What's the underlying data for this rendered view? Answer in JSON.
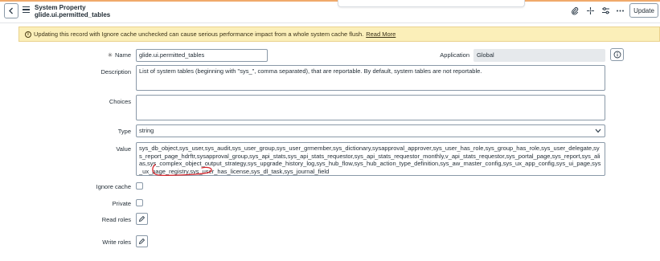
{
  "header": {
    "title_line1": "System Property",
    "title_line2": "glide.ui.permitted_tables",
    "update_label": "Update",
    "icons": [
      "back-icon",
      "menu-icon",
      "paperclip-icon",
      "activity-icon",
      "sliders-icon",
      "more-icon"
    ]
  },
  "warning": {
    "text": "Updating this record with Ignore cache unchecked can cause serious performance impact from a whole system cache flush.",
    "link": "Read More"
  },
  "form": {
    "name_label": "Name",
    "name_value": "glide.ui.permitted_tables",
    "application_label": "Application",
    "application_value": "Global",
    "description_label": "Description",
    "description_value": "List of system tables (beginning with \"sys_\", comma separated), that are reportable. By default, system tables are not reportable.",
    "choices_label": "Choices",
    "choices_value": "",
    "type_label": "Type",
    "type_value": "string",
    "value_label": "Value",
    "value_value": "sys_db_object,sys_user,sys_audit,sys_user_group,sys_user_grmember,sys_dictionary,sysapproval_approver,sys_user_has_role,sys_group_has_role,sys_user_delegate,sys_report_page_hdrftr,sysapproval_group,sys_api_stats,sys_api_stats_requestor,sys_api_stats_requestor_monthly,v_api_stats_requestor,sys_portal_page,sys_report,sys_alias,sys_complex_object_output_strategy,sys_upgrade_history_log,sys_hub_flow,sys_hub_action_type_definition,sys_aw_master_config,sys_ux_app_config,sys_ui_page,sys_ux_page_registry,sys_user_has_license,sys_dl_task,sys_journal_field",
    "ignore_cache_label": "Ignore cache",
    "private_label": "Private",
    "read_roles_label": "Read roles",
    "write_roles_label": "Write roles"
  },
  "colors": {
    "warning_bg": "#fbefb9",
    "annotation": "#d9262c",
    "header_accent": "#f0a96b"
  }
}
